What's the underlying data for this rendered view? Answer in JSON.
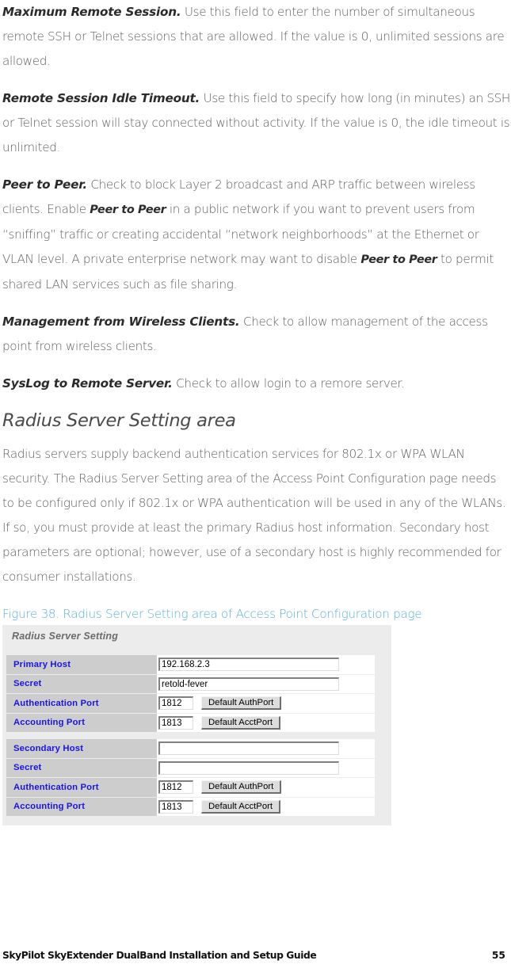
{
  "colors": {
    "body_text": "#5e5e5e",
    "lead_text": "#2b2b2b",
    "caption_blue": "#5aaedd",
    "form_label_blue": "#1a14e0",
    "form_label_bg": "#cdcdcd",
    "figure_bg": "#ececec"
  },
  "paragraphs": [
    {
      "lead": "Maximum Remote Session.",
      "text": " Use this field to enter the number of simultaneous remote SSH or Telnet sessions that are allowed. If the value is 0, unlimited sessions are allowed."
    },
    {
      "lead": "Remote Session Idle Timeout.",
      "text": " Use this field to specify how long (in minutes) an SSH or Telnet session will stay connected without activity. If the value is 0, the idle timeout is unlimited."
    },
    {
      "lead": "Management from Wireless Clients.",
      "text": " Check to allow management of the access point from wireless clients."
    },
    {
      "lead": "SysLog to Remote Server.",
      "text": " Check to allow login to a remore server."
    }
  ],
  "peer_paragraph": {
    "lead": "Peer to Peer.",
    "part1": " Check to block Layer 2 broadcast and ARP traffic between wireless clients. Enable ",
    "em1": "Peer to Peer",
    "part2": " in a public network if you want to prevent users from “sniffing” traffic or creating accidental “network neighborhoods” at the Ethernet or VLAN level. A private enterprise network may want to disable ",
    "em2": "Peer to Peer",
    "part3": " to permit shared LAN services such as file sharing."
  },
  "section": {
    "heading": "Radius Server Setting area",
    "paragraph": "Radius servers supply backend authentication services for 802.1x or WPA WLAN security. The Radius Server Setting area of the Access Point Configuration page needs to be configured only if 802.1x or WPA authentication will be used in any of the WLANs. If so, you must provide at least the primary Radius host information. Secondary host parameters are optional; however, use of a secondary host is highly recommended for consumer installations."
  },
  "figure_caption": "Figure 38. Radius Server Setting area of Access Point Configuration page",
  "figure": {
    "title": "Radius Server Setting",
    "groups": [
      {
        "name": "primary-host-group",
        "rows": [
          {
            "label": "Primary Host",
            "value": "192.168.2.3",
            "input": "wide",
            "button": null
          },
          {
            "label": "Secret",
            "value": "retold-fever",
            "input": "wide",
            "button": null
          },
          {
            "label": "Authentication Port",
            "value": "1812",
            "input": "narrow",
            "button": "Default AuthPort"
          },
          {
            "label": "Accounting Port",
            "value": "1813",
            "input": "narrow",
            "button": "Default AcctPort"
          }
        ]
      },
      {
        "name": "secondary-host-group",
        "rows": [
          {
            "label": "Secondary Host",
            "value": "",
            "input": "wide",
            "button": null
          },
          {
            "label": "Secret",
            "value": "",
            "input": "wide",
            "button": null
          },
          {
            "label": "Authentication Port",
            "value": "1812",
            "input": "narrow",
            "button": "Default AuthPort"
          },
          {
            "label": "Accounting Port",
            "value": "1813",
            "input": "narrow",
            "button": "Default AcctPort"
          }
        ]
      }
    ]
  },
  "footer": {
    "title": "SkyPilot SkyExtender DualBand Installation and Setup Guide",
    "page": "55"
  }
}
